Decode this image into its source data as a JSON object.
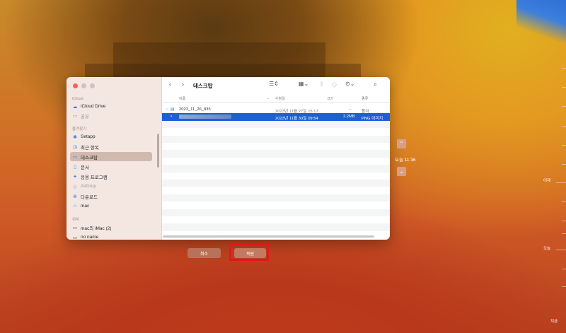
{
  "dialog": {
    "title": "데스크탑",
    "sidebar": {
      "icloud_section": "iCloud",
      "favorites_section": "즐겨찾기",
      "locations_section": "위치",
      "icloud_items": [
        {
          "label": "iCloud Drive",
          "icon": "☁"
        },
        {
          "label": "공유",
          "icon": "▭"
        }
      ],
      "favorite_items": [
        {
          "label": "Setapp",
          "icon": "✱"
        },
        {
          "label": "최근 항목",
          "icon": "◷"
        },
        {
          "label": "데스크탑",
          "icon": "▭"
        },
        {
          "label": "문서",
          "icon": "▯"
        },
        {
          "label": "응용 프로그램",
          "icon": "✦"
        },
        {
          "label": "AirDrop",
          "icon": "◎"
        },
        {
          "label": "다운로드",
          "icon": "⊕"
        },
        {
          "label": "mac",
          "icon": "⌂"
        }
      ],
      "location_items": [
        {
          "label": "mac의 iMac (2)",
          "icon": "▭"
        },
        {
          "label": "no name",
          "icon": "▭"
        }
      ]
    },
    "columns": {
      "name": "이름",
      "modified": "수정일",
      "size": "크기",
      "kind": "종류"
    },
    "files": [
      {
        "name": "2023_11_26_835",
        "modified": "2023년 11월 27일 15:17",
        "size": "--",
        "kind": "폴더"
      },
      {
        "name": "",
        "modified": "2023년 11월 30일 09:54",
        "size": "2.2MB",
        "kind": "PNG 이미지"
      }
    ],
    "buttons": {
      "cancel": "취소",
      "open": "복원"
    }
  },
  "time_nav": {
    "current": "오늘 11:36"
  },
  "timeline": {
    "labels": [
      "어제",
      "오늘",
      "지금"
    ]
  },
  "colors": {
    "selection": "#1f5fd5",
    "highlight_box": "#e8141e",
    "sidebar_bg": "#f4e7e2"
  }
}
